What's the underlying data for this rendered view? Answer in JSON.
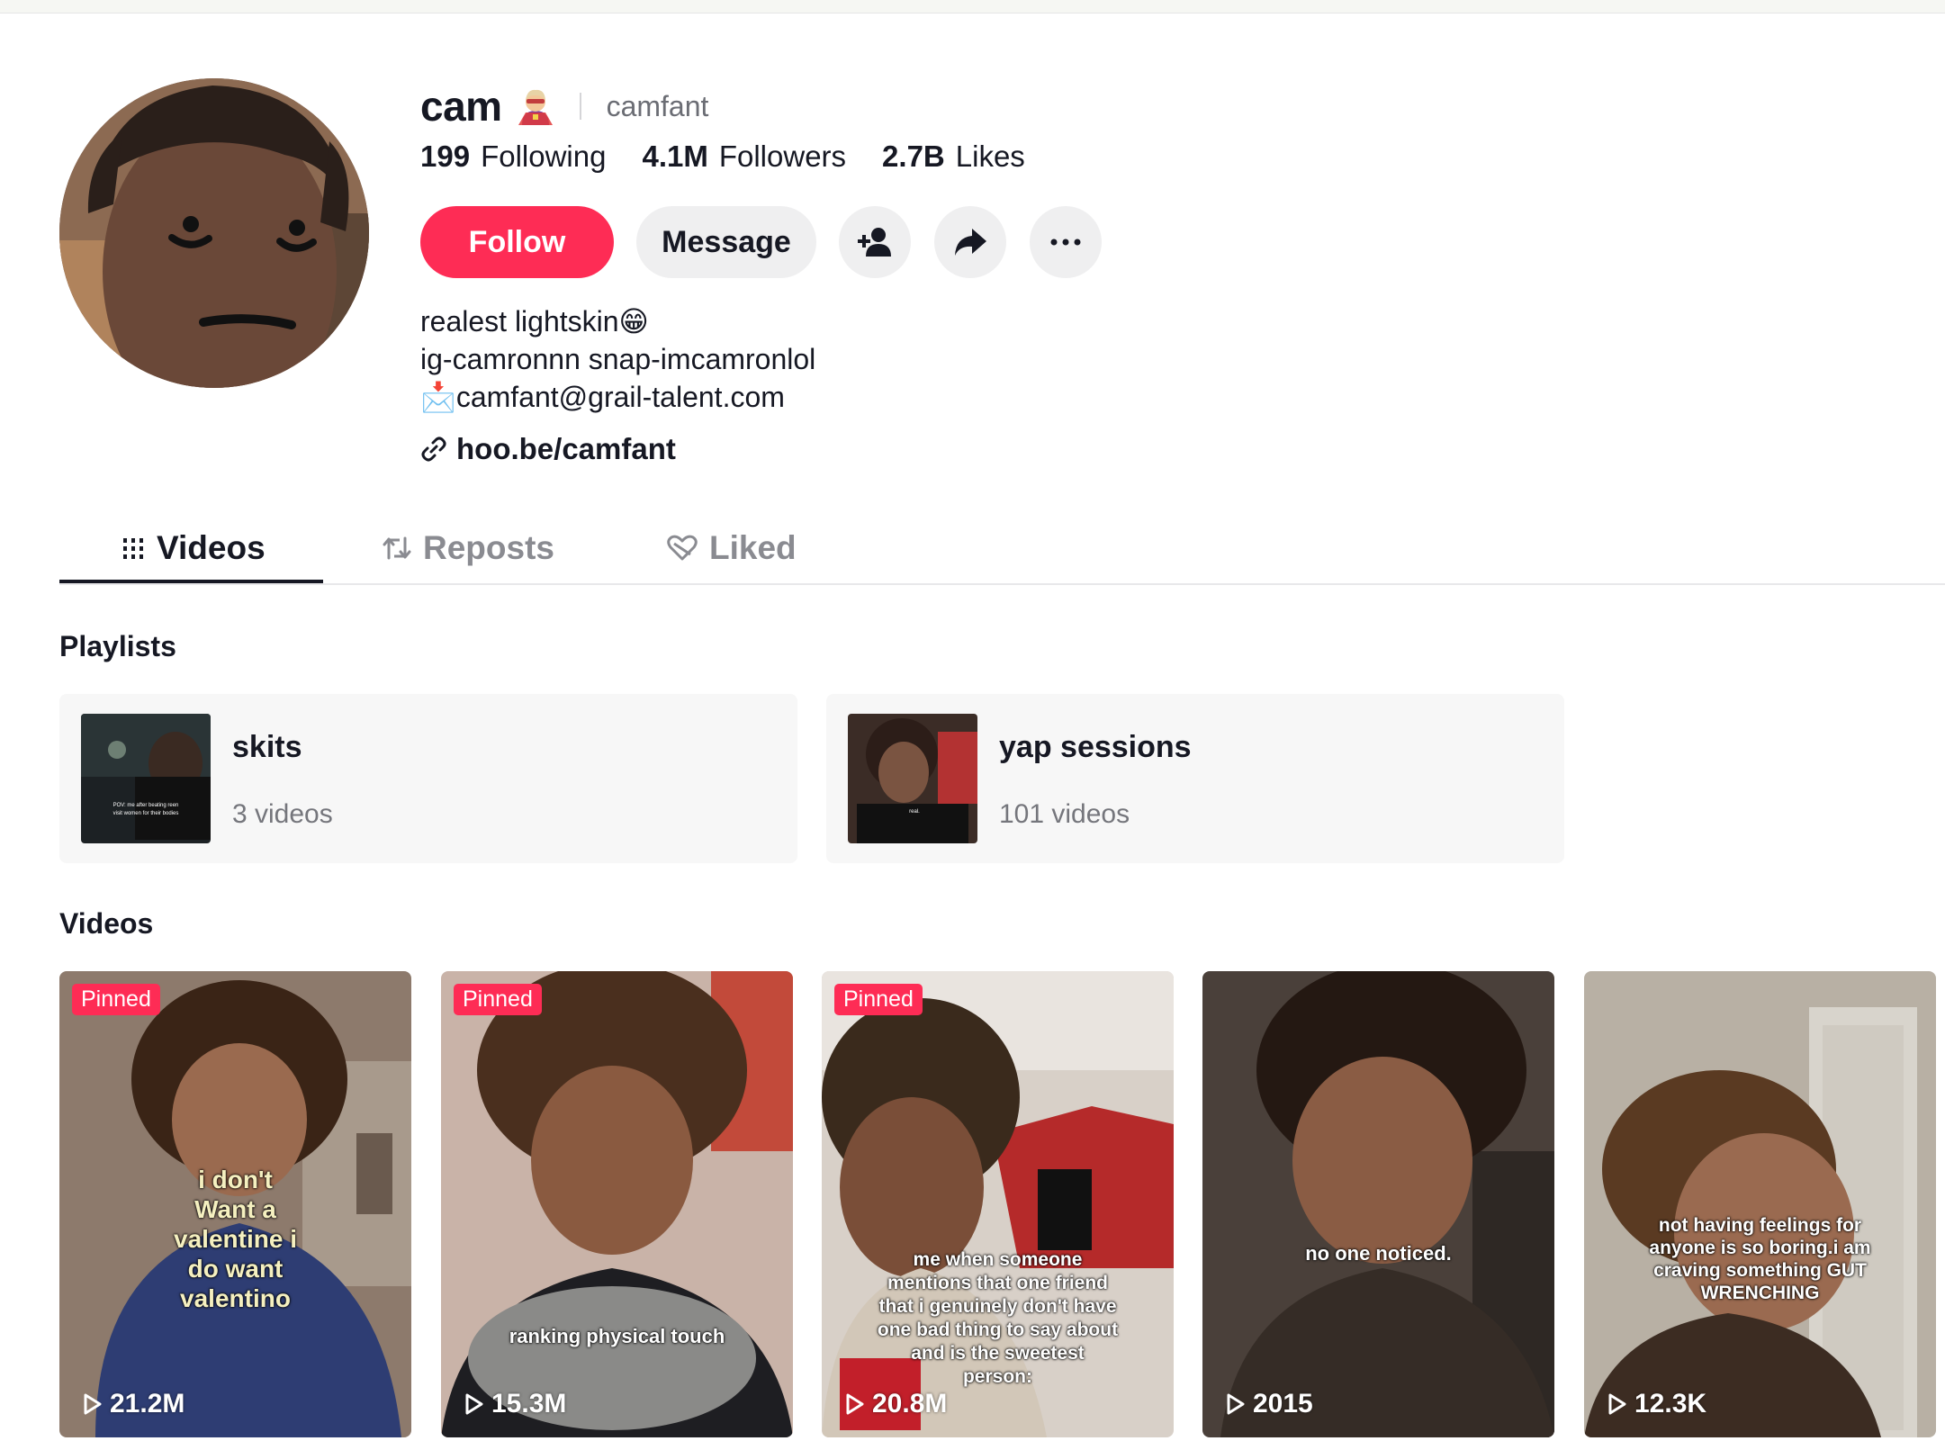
{
  "profile": {
    "display_name": "cam",
    "username": "camfant",
    "stats": [
      {
        "num": "199",
        "label": "Following"
      },
      {
        "num": "4.1M",
        "label": "Followers"
      },
      {
        "num": "2.7B",
        "label": "Likes"
      }
    ],
    "follow_label": "Follow",
    "message_label": "Message",
    "bio": [
      "realest lightskin😁",
      "ig-camronnn snap-imcamronlol",
      "📩camfant@grail-talent.com"
    ],
    "link": "hoo.be/camfant"
  },
  "tabs": [
    {
      "label": "Videos",
      "active": true
    },
    {
      "label": "Reposts",
      "active": false
    },
    {
      "label": "Liked",
      "active": false
    }
  ],
  "sections": {
    "playlists": "Playlists",
    "videos": "Videos"
  },
  "playlists": [
    {
      "title": "skits",
      "count": "3 videos",
      "thumb_text": "POV: me after beating reen visit women for their bodies"
    },
    {
      "title": "yap sessions",
      "count": "101 videos",
      "thumb_text": "real."
    }
  ],
  "videos": [
    {
      "pinned": "Pinned",
      "caption": "i don't\nWant a\nvalentine i\ndo want\nvalentino",
      "views": "21.2M"
    },
    {
      "pinned": "Pinned",
      "caption": "ranking physical touch",
      "views": "15.3M"
    },
    {
      "pinned": "Pinned",
      "caption": "me when someone mentions that one friend that i genuinely don't have one bad thing to say about and is the sweetest person:",
      "views": "20.8M"
    },
    {
      "pinned": "",
      "caption": "no one noticed.",
      "views": "2015"
    },
    {
      "pinned": "",
      "caption": "not having feelings for anyone is so boring.i am craving something GUT WRENCHING",
      "views": "12.3K"
    }
  ],
  "icons": {
    "add_friend": "add-friend-icon",
    "share": "share-icon",
    "more": "more-icon",
    "link": "link-icon",
    "videos_tab": "grid-icon",
    "reposts_tab": "repost-icon",
    "liked_tab": "heart-icon",
    "play": "play-icon"
  },
  "colors": {
    "accent": "#fe2c55",
    "text": "#161823",
    "muted": "#75767c",
    "button_bg": "#efeff0"
  }
}
